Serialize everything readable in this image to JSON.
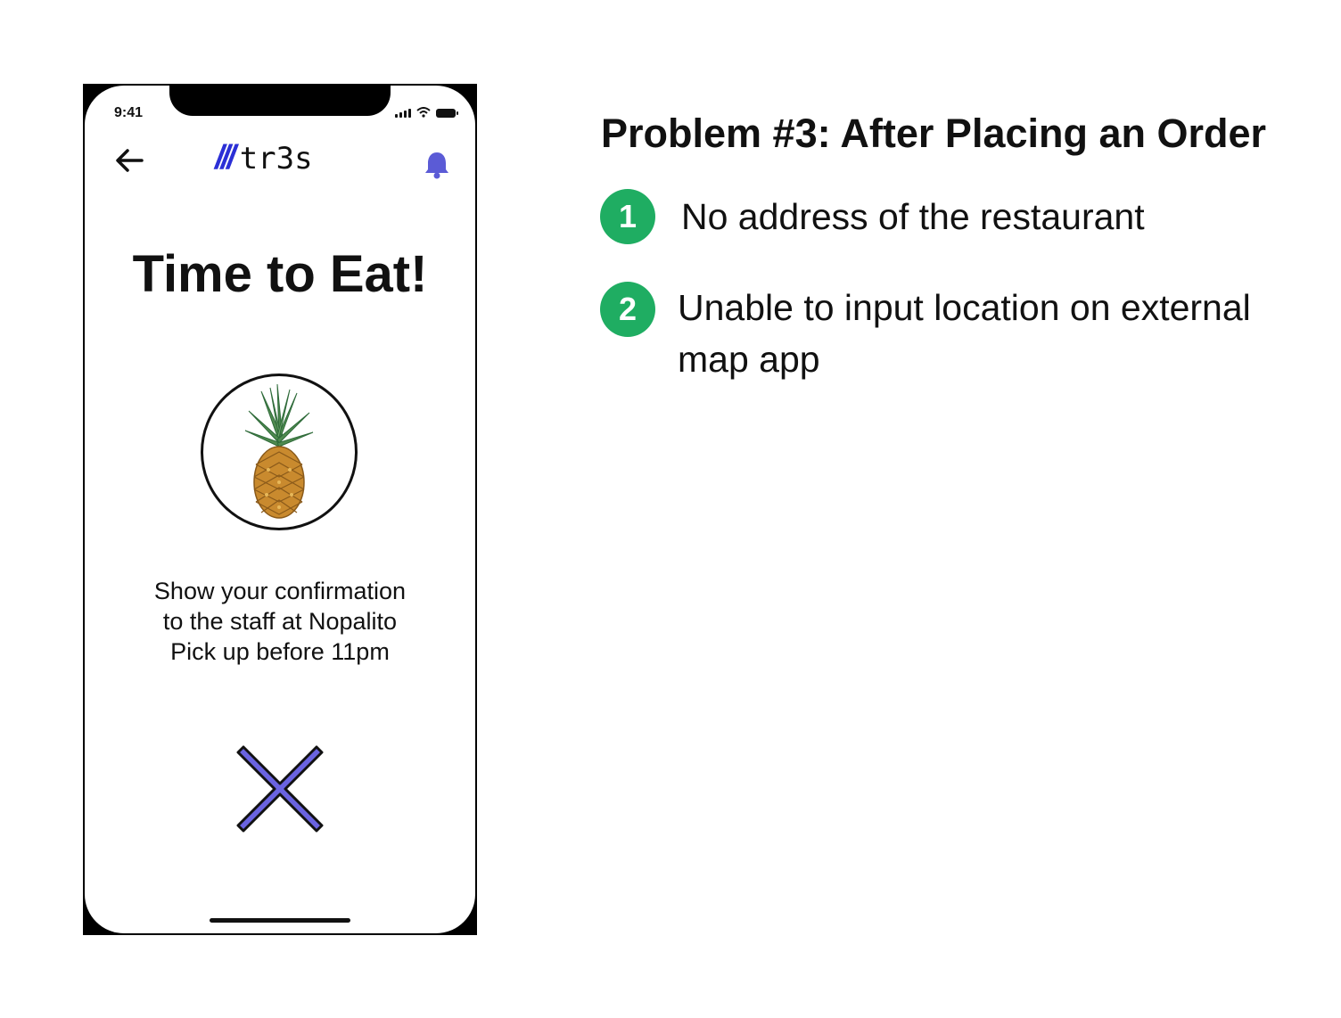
{
  "phone": {
    "status_time": "9:41",
    "logo_slashes": "///",
    "logo_text": "tr3s",
    "title": "Time to Eat!",
    "message_lines": [
      "Show your confirmation",
      "to the staff at Nopalito",
      "Pick up before 11pm"
    ],
    "icons": {
      "back": "arrow-left-icon",
      "bell": "bell-icon",
      "close": "close-icon",
      "image": "pineapple-icon"
    },
    "colors": {
      "accent": "#2b2fd6",
      "bell": "#5b5bd6",
      "close_fill": "#6a63e0"
    }
  },
  "slide": {
    "title": "Problem #3: After Placing an Order",
    "points": [
      {
        "number": "1",
        "text": "No address of the restaurant"
      },
      {
        "number": "2",
        "text": "Unable to input location on external map app"
      }
    ],
    "badge_color": "#1fad62"
  }
}
